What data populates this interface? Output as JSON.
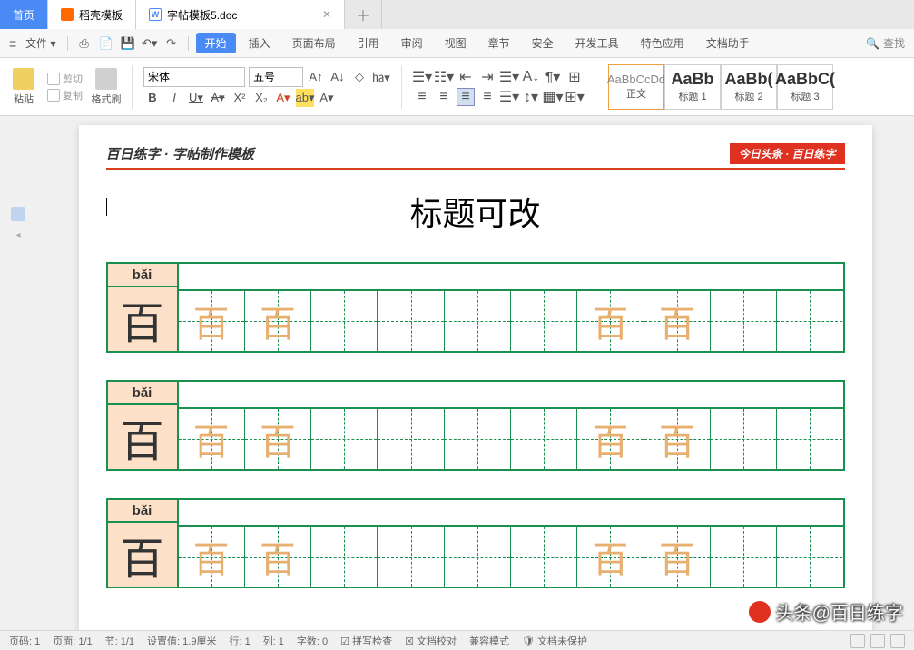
{
  "tabs": {
    "home": "首页",
    "docer": "稻壳模板",
    "doc": "字帖模板5.doc"
  },
  "menu": {
    "file": "文件",
    "start": "开始",
    "insert": "插入",
    "layout": "页面布局",
    "ref": "引用",
    "review": "审阅",
    "view": "视图",
    "chapter": "章节",
    "safe": "安全",
    "dev": "开发工具",
    "special": "特色应用",
    "helper": "文档助手",
    "search": "查找"
  },
  "ribbon": {
    "paste": "粘贴",
    "cut": "剪切",
    "copy": "复制",
    "fmt": "格式刷",
    "font": "宋体",
    "size": "五号",
    "styles": [
      {
        "prev": "AaBbCcDd",
        "name": "正文"
      },
      {
        "prev": "AaBb",
        "name": "标题 1"
      },
      {
        "prev": "AaBb(",
        "name": "标题 2"
      },
      {
        "prev": "AaBbC(",
        "name": "标题 3"
      }
    ]
  },
  "doc": {
    "headerLeft": "百日练字 · 字帖制作模板",
    "headerRight": "今日头条 · 百日练字",
    "title": "标题可改",
    "rows": [
      {
        "pinyin": "bǎi",
        "char": "百",
        "ghosts": [
          "百",
          "百",
          "",
          "",
          "",
          "",
          "百",
          "百",
          "",
          ""
        ]
      },
      {
        "pinyin": "bǎi",
        "char": "百",
        "ghosts": [
          "百",
          "百",
          "",
          "",
          "",
          "",
          "百",
          "百",
          "",
          ""
        ]
      },
      {
        "pinyin": "bǎi",
        "char": "百",
        "ghosts": [
          "百",
          "百",
          "",
          "",
          "",
          "",
          "百",
          "百",
          "",
          ""
        ]
      }
    ]
  },
  "status": {
    "page": "页码: 1",
    "pages": "页面: 1/1",
    "section": "节: 1/1",
    "setval": "设置值: 1.9厘米",
    "row": "行: 1",
    "col": "列: 1",
    "chars": "字数: 0",
    "spell": "拼写检查",
    "proof": "文档校对",
    "compat": "兼容模式",
    "protect": "文档未保护"
  },
  "watermark": "头条@百日练字"
}
